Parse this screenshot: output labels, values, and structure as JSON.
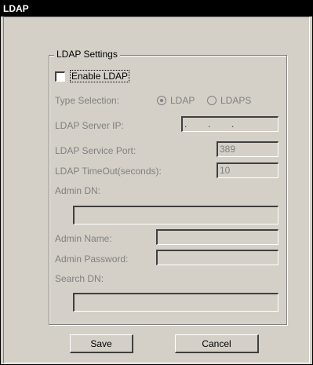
{
  "window": {
    "title": "LDAP"
  },
  "group": {
    "title": "LDAP Settings"
  },
  "enable": {
    "label": "Enable LDAP",
    "checked": false
  },
  "type_selection": {
    "label": "Type Selection:",
    "options": [
      "LDAP",
      "LDAPS"
    ],
    "selected": "LDAP"
  },
  "server_ip": {
    "label": "LDAP Server IP:",
    "value": ".        .        ."
  },
  "service_port": {
    "label": "LDAP Service Port:",
    "value": "389"
  },
  "timeout": {
    "label": "LDAP TimeOut(seconds):",
    "value": "10"
  },
  "admin_dn": {
    "label": "Admin DN:",
    "value": ""
  },
  "admin_name": {
    "label": "Admin Name:",
    "value": ""
  },
  "admin_password": {
    "label": "Admin Password:",
    "value": ""
  },
  "search_dn": {
    "label": "Search DN:",
    "value": ""
  },
  "buttons": {
    "save": "Save",
    "cancel": "Cancel"
  }
}
